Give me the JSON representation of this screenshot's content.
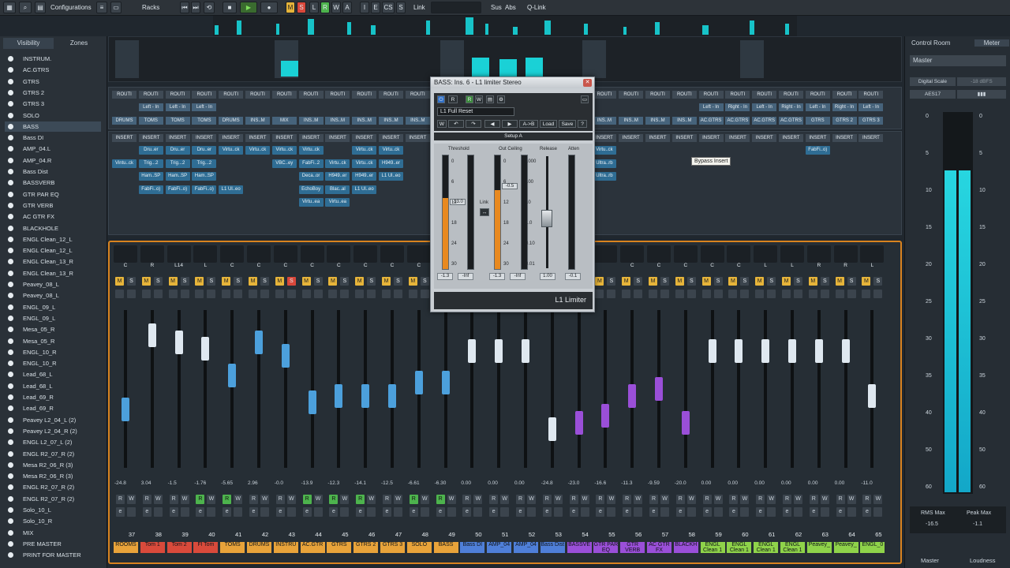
{
  "toolbar": {
    "configurations_label": "Configurations",
    "racks_label": "Racks",
    "link_label": "Link",
    "sus_label": "Sus",
    "abs_label": "Abs",
    "qlink_label": "Q-Link",
    "mode_buttons": [
      "M",
      "S",
      "L",
      "R",
      "W",
      "A"
    ],
    "view_buttons": [
      "I",
      "E",
      "CS",
      "S"
    ],
    "colors": {
      "mute": "#e6b43a",
      "solo": "#d9483b",
      "read": "#4db34d"
    }
  },
  "left_panel": {
    "tabs": [
      "Visibility",
      "Zones"
    ],
    "items": [
      "INSTRUM.",
      "AC.GTRS",
      "GTRS",
      "GTRS 2",
      "GTRS 3",
      "SOLO",
      "BASS",
      "Bass DI",
      "AMP_04.L",
      "AMP_04.R",
      "Bass Dist",
      "BASSVERB",
      "GTR PAR EQ",
      "GTR VERB",
      "AC GTR FX",
      "BLACKHOLE",
      "ENGL Clean_12_L",
      "ENGL Clean_12_L",
      "ENGL Clean_13_R",
      "ENGL Clean_13_R",
      "Peavey_08_L",
      "Peavey_08_L",
      "ENGL_09_L",
      "ENGL_09_L",
      "Mesa_05_R",
      "Mesa_05_R",
      "ENGL_10_R",
      "ENGL_10_R",
      "Lead_68_L",
      "Lead_68_L",
      "Lead_69_R",
      "Lead_69_R",
      "Peavey L2_04_L (2)",
      "Peavey L2_04_R (2)",
      "ENGL L2_07_L (2)",
      "ENGL R2_07_R (2)",
      "Mesa R2_06_R (3)",
      "Mesa R2_06_R (3)",
      "ENGL R2_07_R (2)",
      "ENGL R2_07_R (2)",
      "Solo_10_L",
      "Solo_10_R",
      "MIX",
      "PRE MASTER",
      "PRINT FOR MASTER"
    ],
    "selected_index": 6
  },
  "right_panel": {
    "tabs": [
      "Control Room",
      "Meter"
    ],
    "master_label": "Master",
    "digital_scale_label": "Digital Scale",
    "scale_value": "-18 dBFS",
    "aes_label": "AES17",
    "scale_ticks": [
      "0",
      "5",
      "10",
      "15",
      "20",
      "25",
      "30",
      "35",
      "40",
      "50",
      "60"
    ],
    "rms_max_label": "RMS Max",
    "rms_max_value": "-16.5",
    "peak_max_label": "Peak Max",
    "peak_max_value": "-1.1",
    "master_footer": "Master",
    "loudness_footer": "Loudness",
    "meter_levels": {
      "left": 0.85,
      "right": 0.85
    }
  },
  "routing": {
    "header": "ROUTI",
    "left_row": [
      "",
      "Left - In",
      "Left - In",
      "Left - In",
      "",
      "",
      "",
      "",
      "",
      "",
      "",
      "",
      "",
      "",
      "",
      "",
      "",
      "",
      "",
      "",
      "",
      "",
      "Left - In",
      "Right - In",
      "Left - In",
      "Right - In",
      "Left - In",
      "Right - In",
      "Left - In"
    ],
    "right_row": [
      "DRUMS",
      "TOMS",
      "TOMS",
      "TOMS",
      "DRUMS",
      "INS..M",
      "MIX",
      "INS..M",
      "INS..M",
      "INS..M",
      "INS..M",
      "INS..M",
      "",
      "",
      "",
      "",
      "",
      "",
      "INS..M",
      "INS..M",
      "INS..M",
      "INS..M",
      "AC.GTRS",
      "AC.GTRS",
      "AC.GTRS",
      "AC.GTRS",
      "GTRS",
      "GTRS 2",
      "GTRS 3"
    ]
  },
  "inserts": {
    "header": "INSERT",
    "slots": [
      [
        "",
        "Vintu..ck"
      ],
      [
        "Dru..er",
        "Trig...2",
        "Ham..SP",
        "FabFi..o)"
      ],
      [
        "Dru..er",
        "Trig...2",
        "Ham..SP",
        "FabFi..o)"
      ],
      [
        "Dru..er",
        "Trig...2",
        "Ham..SP",
        "FabFi..o)"
      ],
      [
        "Virtu..ck",
        "",
        "",
        "L1 Ul..eo"
      ],
      [
        "Virtu..ck"
      ],
      [
        "Virtu..ck",
        "VBC..ey"
      ],
      [
        "Virtu..ck",
        "FabFi..2",
        "Deca..or",
        "EchoBoy",
        "Virtu..ea"
      ],
      [
        "",
        "Virtu..ck",
        "H949..er",
        "Blac..al",
        "Virtu..ea"
      ],
      [
        "Virtu..ck",
        "Virtu..ck",
        "H949..er",
        "L1 Ul..eo"
      ],
      [
        "Virtu..ck",
        "H949..er",
        "L1 Ul..eo"
      ],
      [
        "Virtu..ck",
        "Ultra..rb",
        "Ultra..rb"
      ],
      [
        "FabFi..o)"
      ]
    ],
    "tooltip": "Bypass Insert"
  },
  "plugin": {
    "title": "BASS: Ins. 6 - L1 limiter Stereo",
    "preset": "L1 Full Reset",
    "setup_label": "Setup A",
    "compare_buttons": [
      "A->B",
      "Load",
      "Save",
      "?"
    ],
    "threshold_label": "Threshold",
    "out_ceiling_label": "Out Ceiling",
    "release_label": "Release",
    "atten_label": "Atten",
    "link_label": "Link",
    "threshold_value": "-13.0",
    "ceiling_value": "-0.5",
    "release_value": "1.00",
    "atten_value": "-0.1",
    "in_meter_values": [
      "-1.3",
      "-Inf"
    ],
    "out_meter_values": [
      "-1.3",
      "-Inf"
    ],
    "scale": [
      "0",
      "6",
      "12",
      "18",
      "24",
      "30"
    ],
    "release_scale": [
      "1000",
      "100",
      "10",
      "1.0",
      "0.10",
      "0.01"
    ],
    "footer": "L1 Limiter",
    "threshold_level": 0.4,
    "ceiling_level": 0.7,
    "release_level": 0.5
  },
  "channels": {
    "pan_labels": [
      "C",
      "R",
      "L14",
      "L",
      "C",
      "C",
      "C",
      "C",
      "C",
      "C",
      "C",
      "C",
      "C",
      "",
      "",
      "",
      "",
      "",
      "",
      "C",
      "C",
      "C",
      "C",
      "C",
      "L",
      "L",
      "R",
      "R",
      "L",
      "L",
      "L"
    ],
    "values": [
      "-24.8",
      "3.04",
      "-1.5",
      "-1.76",
      "-5.65",
      "2.96",
      "-0.0",
      "-13.9",
      "-12.3",
      "-14.1",
      "-12.5",
      "-6.61",
      "-6.30",
      "0.00",
      "0.00",
      "0.00",
      "-24.8",
      "-23.0",
      "-16.6",
      "-11.3",
      "-9.59",
      "-20.0",
      "0.00",
      "0.00",
      "0.00",
      "0.00",
      "0.00",
      "0.00",
      "-11.0"
    ],
    "numbers": [
      "37",
      "38",
      "39",
      "40",
      "41",
      "42",
      "43",
      "44",
      "45",
      "46",
      "47",
      "48",
      "49",
      "50",
      "51",
      "52",
      "53",
      "54",
      "55",
      "56",
      "57",
      "58",
      "59",
      "60",
      "61",
      "62",
      "63",
      "64",
      "65"
    ],
    "names": [
      "ROOMS",
      "Tom 1",
      "Tom 2",
      "Fl Tom",
      "TOMS",
      "DRUMS",
      "INSTRU",
      "AC.GTR",
      "GTRS",
      "GTRS 2",
      "GTRS 3",
      "SOLO",
      "BASS",
      "Bass DI",
      "AMP_04",
      "AMP_04",
      "Bass Dist",
      "BASSVE",
      "GTR PAR EQ",
      "GTR VERB",
      "AC GTR FX",
      "BLACKH",
      "ENGL Clean 1",
      "ENGL Clean 1",
      "ENGL Clean 1",
      "ENGL Clean 1",
      "Peavey_",
      "Peavey_",
      "ENGL_0"
    ],
    "name_colors": [
      "#e8a33a",
      "#d94a3b",
      "#d94a3b",
      "#d94a3b",
      "#e8a33a",
      "#e8a33a",
      "#e8a33a",
      "#e8a33a",
      "#e8a33a",
      "#e8a33a",
      "#e8a33a",
      "#e8a33a",
      "#e8a33a",
      "#4f7fd8",
      "#4f7fd8",
      "#4f7fd8",
      "#4f7fd8",
      "#9a4fd8",
      "#9a4fd8",
      "#9a4fd8",
      "#9a4fd8",
      "#9a4fd8",
      "#8fd34a",
      "#8fd34a",
      "#8fd34a",
      "#8fd34a",
      "#8fd34a",
      "#8fd34a",
      "#8fd34a"
    ],
    "fader_levels": [
      0.35,
      0.9,
      0.85,
      0.8,
      0.6,
      0.85,
      0.75,
      0.4,
      0.45,
      0.45,
      0.45,
      0.55,
      0.55,
      0.78,
      0.78,
      0.78,
      0.2,
      0.25,
      0.3,
      0.45,
      0.5,
      0.25,
      0.78,
      0.78,
      0.78,
      0.78,
      0.78,
      0.78,
      0.45
    ],
    "fader_colors": [
      "#4ca0dc",
      "#dfe8f0",
      "#dfe8f0",
      "#dfe8f0",
      "#4ca0dc",
      "#4ca0dc",
      "#4ca0dc",
      "#4ca0dc",
      "#4ca0dc",
      "#4ca0dc",
      "#4ca0dc",
      "#4ca0dc",
      "#4ca0dc",
      "#dfe8f0",
      "#dfe8f0",
      "#dfe8f0",
      "#dfe8f0",
      "#9a4fd8",
      "#9a4fd8",
      "#9a4fd8",
      "#9a4fd8",
      "#9a4fd8",
      "#dfe8f0",
      "#dfe8f0",
      "#dfe8f0",
      "#dfe8f0",
      "#dfe8f0",
      "#dfe8f0",
      "#dfe8f0"
    ],
    "read_on": [
      false,
      false,
      false,
      true,
      true,
      false,
      false,
      true,
      true,
      true,
      false,
      true,
      true,
      false,
      false,
      false,
      false,
      false,
      false,
      false,
      false,
      false,
      false,
      false,
      false,
      false,
      false,
      false,
      false
    ],
    "solo_on_index": 6,
    "btn_m": "M",
    "btn_s": "S",
    "btn_r": "R",
    "btn_w": "W",
    "btn_e": "e"
  }
}
